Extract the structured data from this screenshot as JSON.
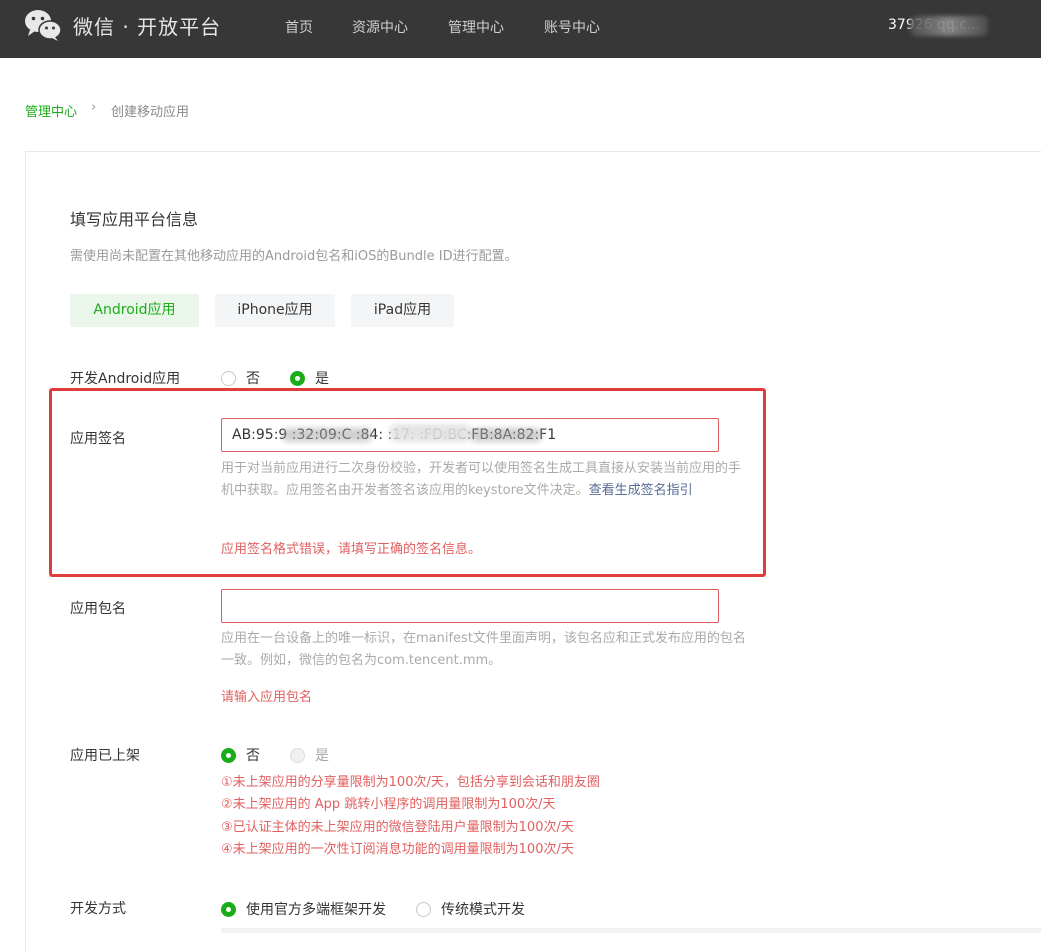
{
  "header": {
    "brand": "微信 · 开放平台",
    "nav": [
      "首页",
      "资源中心",
      "管理中心",
      "账号中心"
    ],
    "account": "37926      qq.c..."
  },
  "breadcrumb": {
    "root": "管理中心",
    "separator": "›",
    "current": "创建移动应用"
  },
  "section": {
    "title": "填写应用平台信息",
    "description": "需使用尚未配置在其他移动应用的Android包名和iOS的Bundle ID进行配置。"
  },
  "platform_tabs": [
    {
      "label": "Android应用",
      "active": true
    },
    {
      "label": "iPhone应用",
      "active": false
    },
    {
      "label": "iPad应用",
      "active": false
    }
  ],
  "dev_android": {
    "label": "开发Android应用",
    "options": [
      {
        "label": "否",
        "checked": false
      },
      {
        "label": "是",
        "checked": true
      }
    ]
  },
  "signature": {
    "label": "应用签名",
    "value": "AB:95:9           :32:09:C          :84:    :17:            :FD:BC:FB:8A:82:F1",
    "hint_text": "用于对当前应用进行二次身份校验，开发者可以使用签名生成工具直接从安装当前应用的手机中获取。应用签名由开发者签名该应用的keystore文件决定。",
    "hint_link": "查看生成签名指引",
    "error": "应用签名格式错误，请填写正确的签名信息。"
  },
  "package": {
    "label": "应用包名",
    "value": "",
    "hint": "应用在一台设备上的唯一标识，在manifest文件里面声明，该包名应和正式发布应用的包名一致。例如，微信的包名为com.tencent.mm。",
    "error": "请输入应用包名"
  },
  "listed": {
    "label": "应用已上架",
    "options": [
      {
        "label": "否",
        "checked": true,
        "disabled": false
      },
      {
        "label": "是",
        "checked": false,
        "disabled": true
      }
    ],
    "limits": [
      "①未上架应用的分享量限制为100次/天，包括分享到会话和朋友圈",
      "②未上架应用的 App 跳转小程序的调用量限制为100次/天",
      "③已认证主体的未上架应用的微信登陆用户量限制为100次/天",
      "④未上架应用的一次性订阅消息功能的调用量限制为100次/天"
    ]
  },
  "dev_mode": {
    "label": "开发方式",
    "options": [
      {
        "label": "使用官方多端框架开发",
        "checked": true
      },
      {
        "label": "传统模式开发",
        "checked": false
      }
    ]
  },
  "colors": {
    "accent": "#1aad19",
    "error": "#e15f5f",
    "header_bg": "#373737",
    "link": "#576b95",
    "highlight": "#e03c3c"
  }
}
